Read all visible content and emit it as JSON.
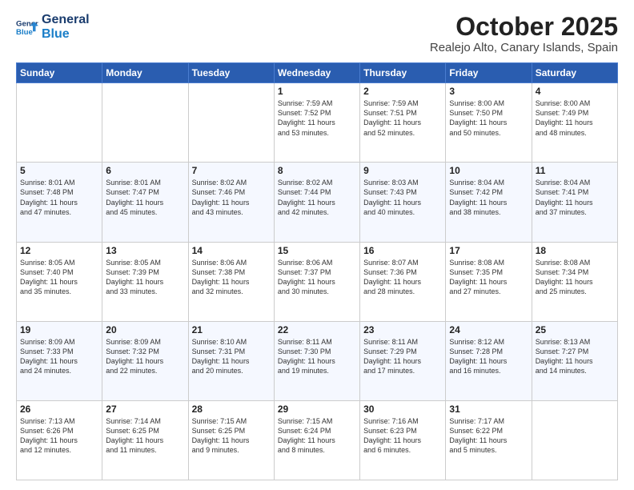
{
  "logo": {
    "line1": "General",
    "line2": "Blue"
  },
  "header": {
    "month": "October 2025",
    "location": "Realejo Alto, Canary Islands, Spain"
  },
  "weekdays": [
    "Sunday",
    "Monday",
    "Tuesday",
    "Wednesday",
    "Thursday",
    "Friday",
    "Saturday"
  ],
  "weeks": [
    [
      {
        "day": "",
        "info": ""
      },
      {
        "day": "",
        "info": ""
      },
      {
        "day": "",
        "info": ""
      },
      {
        "day": "1",
        "info": "Sunrise: 7:59 AM\nSunset: 7:52 PM\nDaylight: 11 hours\nand 53 minutes."
      },
      {
        "day": "2",
        "info": "Sunrise: 7:59 AM\nSunset: 7:51 PM\nDaylight: 11 hours\nand 52 minutes."
      },
      {
        "day": "3",
        "info": "Sunrise: 8:00 AM\nSunset: 7:50 PM\nDaylight: 11 hours\nand 50 minutes."
      },
      {
        "day": "4",
        "info": "Sunrise: 8:00 AM\nSunset: 7:49 PM\nDaylight: 11 hours\nand 48 minutes."
      }
    ],
    [
      {
        "day": "5",
        "info": "Sunrise: 8:01 AM\nSunset: 7:48 PM\nDaylight: 11 hours\nand 47 minutes."
      },
      {
        "day": "6",
        "info": "Sunrise: 8:01 AM\nSunset: 7:47 PM\nDaylight: 11 hours\nand 45 minutes."
      },
      {
        "day": "7",
        "info": "Sunrise: 8:02 AM\nSunset: 7:46 PM\nDaylight: 11 hours\nand 43 minutes."
      },
      {
        "day": "8",
        "info": "Sunrise: 8:02 AM\nSunset: 7:44 PM\nDaylight: 11 hours\nand 42 minutes."
      },
      {
        "day": "9",
        "info": "Sunrise: 8:03 AM\nSunset: 7:43 PM\nDaylight: 11 hours\nand 40 minutes."
      },
      {
        "day": "10",
        "info": "Sunrise: 8:04 AM\nSunset: 7:42 PM\nDaylight: 11 hours\nand 38 minutes."
      },
      {
        "day": "11",
        "info": "Sunrise: 8:04 AM\nSunset: 7:41 PM\nDaylight: 11 hours\nand 37 minutes."
      }
    ],
    [
      {
        "day": "12",
        "info": "Sunrise: 8:05 AM\nSunset: 7:40 PM\nDaylight: 11 hours\nand 35 minutes."
      },
      {
        "day": "13",
        "info": "Sunrise: 8:05 AM\nSunset: 7:39 PM\nDaylight: 11 hours\nand 33 minutes."
      },
      {
        "day": "14",
        "info": "Sunrise: 8:06 AM\nSunset: 7:38 PM\nDaylight: 11 hours\nand 32 minutes."
      },
      {
        "day": "15",
        "info": "Sunrise: 8:06 AM\nSunset: 7:37 PM\nDaylight: 11 hours\nand 30 minutes."
      },
      {
        "day": "16",
        "info": "Sunrise: 8:07 AM\nSunset: 7:36 PM\nDaylight: 11 hours\nand 28 minutes."
      },
      {
        "day": "17",
        "info": "Sunrise: 8:08 AM\nSunset: 7:35 PM\nDaylight: 11 hours\nand 27 minutes."
      },
      {
        "day": "18",
        "info": "Sunrise: 8:08 AM\nSunset: 7:34 PM\nDaylight: 11 hours\nand 25 minutes."
      }
    ],
    [
      {
        "day": "19",
        "info": "Sunrise: 8:09 AM\nSunset: 7:33 PM\nDaylight: 11 hours\nand 24 minutes."
      },
      {
        "day": "20",
        "info": "Sunrise: 8:09 AM\nSunset: 7:32 PM\nDaylight: 11 hours\nand 22 minutes."
      },
      {
        "day": "21",
        "info": "Sunrise: 8:10 AM\nSunset: 7:31 PM\nDaylight: 11 hours\nand 20 minutes."
      },
      {
        "day": "22",
        "info": "Sunrise: 8:11 AM\nSunset: 7:30 PM\nDaylight: 11 hours\nand 19 minutes."
      },
      {
        "day": "23",
        "info": "Sunrise: 8:11 AM\nSunset: 7:29 PM\nDaylight: 11 hours\nand 17 minutes."
      },
      {
        "day": "24",
        "info": "Sunrise: 8:12 AM\nSunset: 7:28 PM\nDaylight: 11 hours\nand 16 minutes."
      },
      {
        "day": "25",
        "info": "Sunrise: 8:13 AM\nSunset: 7:27 PM\nDaylight: 11 hours\nand 14 minutes."
      }
    ],
    [
      {
        "day": "26",
        "info": "Sunrise: 7:13 AM\nSunset: 6:26 PM\nDaylight: 11 hours\nand 12 minutes."
      },
      {
        "day": "27",
        "info": "Sunrise: 7:14 AM\nSunset: 6:25 PM\nDaylight: 11 hours\nand 11 minutes."
      },
      {
        "day": "28",
        "info": "Sunrise: 7:15 AM\nSunset: 6:25 PM\nDaylight: 11 hours\nand 9 minutes."
      },
      {
        "day": "29",
        "info": "Sunrise: 7:15 AM\nSunset: 6:24 PM\nDaylight: 11 hours\nand 8 minutes."
      },
      {
        "day": "30",
        "info": "Sunrise: 7:16 AM\nSunset: 6:23 PM\nDaylight: 11 hours\nand 6 minutes."
      },
      {
        "day": "31",
        "info": "Sunrise: 7:17 AM\nSunset: 6:22 PM\nDaylight: 11 hours\nand 5 minutes."
      },
      {
        "day": "",
        "info": ""
      }
    ]
  ]
}
